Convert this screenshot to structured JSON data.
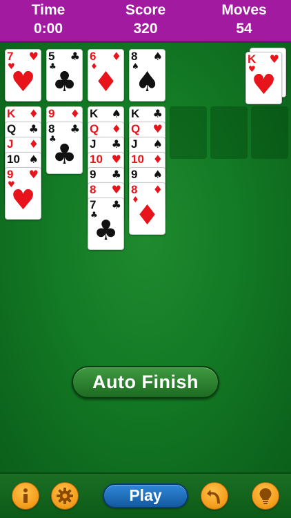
{
  "header": {
    "time_label": "Time",
    "time_value": "0:00",
    "score_label": "Score",
    "score_value": "320",
    "moves_label": "Moves",
    "moves_value": "54"
  },
  "cards": {
    "h7": {
      "rank": "7",
      "suit": "♥"
    },
    "c5": {
      "rank": "5",
      "suit": "♣"
    },
    "d6": {
      "rank": "6",
      "suit": "♦"
    },
    "s8": {
      "rank": "8",
      "suit": "♠"
    },
    "hK_found": {
      "rank": "K",
      "suit": "♥"
    },
    "dK": {
      "rank": "K",
      "suit": "♦"
    },
    "cQ": {
      "rank": "Q",
      "suit": "♣"
    },
    "dJ": {
      "rank": "J",
      "suit": "♦"
    },
    "s10": {
      "rank": "10",
      "suit": "♠"
    },
    "h9": {
      "rank": "9",
      "suit": "♥"
    },
    "d9": {
      "rank": "9",
      "suit": "♦"
    },
    "c8": {
      "rank": "8",
      "suit": "♣"
    },
    "sK": {
      "rank": "K",
      "suit": "♠"
    },
    "dQ": {
      "rank": "Q",
      "suit": "♦"
    },
    "cJ": {
      "rank": "J",
      "suit": "♣"
    },
    "h10": {
      "rank": "10",
      "suit": "♥"
    },
    "c9": {
      "rank": "9",
      "suit": "♣"
    },
    "h8": {
      "rank": "8",
      "suit": "♥"
    },
    "c7": {
      "rank": "7",
      "suit": "♣"
    },
    "cK": {
      "rank": "K",
      "suit": "♣"
    },
    "hQ": {
      "rank": "Q",
      "suit": "♥"
    },
    "sJ": {
      "rank": "J",
      "suit": "♠"
    },
    "d10": {
      "rank": "10",
      "suit": "♦"
    },
    "s9": {
      "rank": "9",
      "suit": "♠"
    },
    "d8": {
      "rank": "8",
      "suit": "♦"
    }
  },
  "auto_finish_label": "Auto Finish",
  "toolbar": {
    "info_icon": "info-icon",
    "settings_icon": "gear-icon",
    "play_label": "Play",
    "undo_icon": "undo-icon",
    "hint_icon": "lightbulb-icon"
  },
  "colors": {
    "header_bg": "#a11aa0",
    "table_bg": "#137a25",
    "red_suit": "#e8141b",
    "black_suit": "#111111",
    "play_button": "#2f87d8",
    "round_button": "#f5a01f"
  }
}
